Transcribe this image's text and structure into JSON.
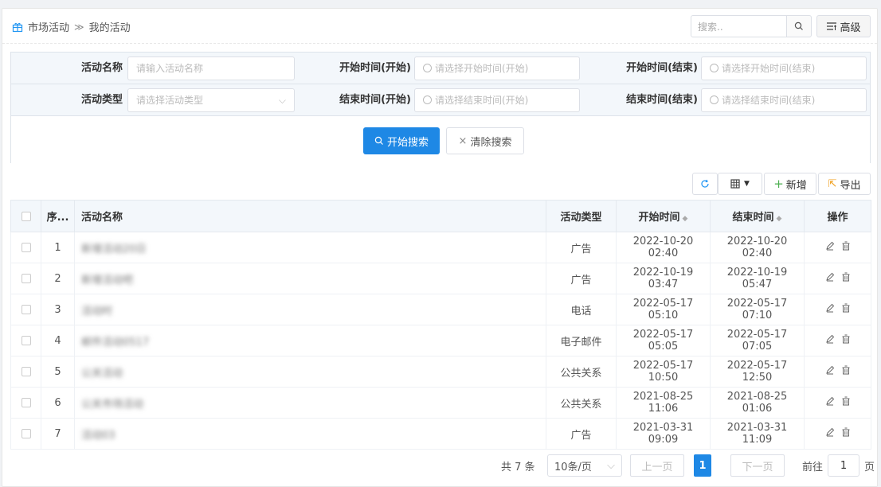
{
  "breadcrumb": {
    "root": "市场活动",
    "separator": "≫",
    "current": "我的活动"
  },
  "search": {
    "placeholder": "搜索..",
    "advanced_label": "高级"
  },
  "filters": {
    "name_label": "活动名称",
    "name_placeholder": "请输入活动名称",
    "type_label": "活动类型",
    "type_placeholder": "请选择活动类型",
    "start_from_label": "开始时间(开始)",
    "start_from_placeholder": "请选择开始时间(开始)",
    "end_from_label": "结束时间(开始)",
    "end_from_placeholder": "请选择结束时间(开始)",
    "start_to_label": "开始时间(结束)",
    "start_to_placeholder": "请选择开始时间(结束)",
    "end_to_label": "结束时间(结束)",
    "end_to_placeholder": "请选择结束时间(结束)",
    "search_button": "开始搜索",
    "clear_button": "清除搜索"
  },
  "toolbar": {
    "add_label": "新增",
    "export_label": "导出"
  },
  "table": {
    "headers": {
      "index": "序...",
      "name": "活动名称",
      "type": "活动类型",
      "start": "开始时间",
      "end": "结束时间",
      "ops": "操作"
    },
    "rows": [
      {
        "index": "1",
        "name": "新增活动20日",
        "type": "广告",
        "start": "2022-10-20 02:40",
        "end": "2022-10-20 02:40"
      },
      {
        "index": "2",
        "name": "新增活动吧",
        "type": "广告",
        "start": "2022-10-19 03:47",
        "end": "2022-10-19 05:47"
      },
      {
        "index": "3",
        "name": "活动时",
        "type": "电话",
        "start": "2022-05-17 05:10",
        "end": "2022-05-17 07:10"
      },
      {
        "index": "4",
        "name": "邮件活动0517",
        "type": "电子邮件",
        "start": "2022-05-17 05:05",
        "end": "2022-05-17 07:05"
      },
      {
        "index": "5",
        "name": "公关活动",
        "type": "公共关系",
        "start": "2022-05-17 10:50",
        "end": "2022-05-17 12:50"
      },
      {
        "index": "6",
        "name": "公关市场活动",
        "type": "公共关系",
        "start": "2021-08-25 11:06",
        "end": "2021-08-25 01:06"
      },
      {
        "index": "7",
        "name": "活动03",
        "type": "广告",
        "start": "2021-03-31 09:09",
        "end": "2021-03-31 11:09"
      }
    ]
  },
  "pagination": {
    "total": "共 7 条",
    "page_size": "10条/页",
    "prev": "上一页",
    "current": "1",
    "next": "下一页",
    "goto_prefix": "前往",
    "goto_value": "1",
    "goto_suffix": "页"
  }
}
